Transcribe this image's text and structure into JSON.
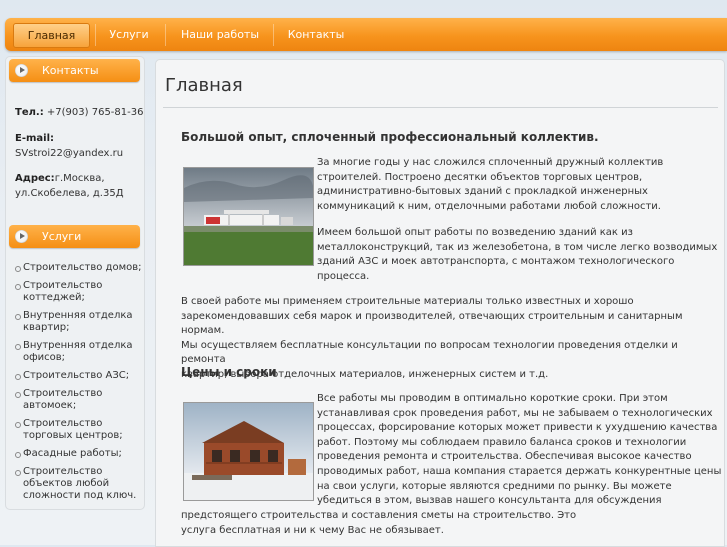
{
  "nav": {
    "items": [
      {
        "label": "Главная",
        "active": true
      },
      {
        "label": "Услуги"
      },
      {
        "label": "Наши работы"
      },
      {
        "label": "Контакты"
      }
    ]
  },
  "sidebar": {
    "contacts_title": "Контакты",
    "phone_label": "Тел.:",
    "phone_value": " +7(903) 765-81-36",
    "email_label": "E-mail:",
    "email_value": "SVstroi22@yandex.ru",
    "address_label": "Адрес:",
    "address_line1": "г.Москва,",
    "address_line2": "ул.Скобелева, д.35Д",
    "services_title": "Услуги",
    "services": [
      "Строительство домов;",
      "Строительство коттеджей;",
      "Внутренняя отделка квартир;",
      "Внутренняя отделка офисов;",
      "Строительство АЗС;",
      "Строительство автомоек;",
      "Строительство торговых центров;",
      "Фасадные работы;",
      "Строительство объектов любой сложности под ключ."
    ]
  },
  "main": {
    "title": "Главная",
    "heading1": "Большой опыт, сплоченный профессиональный коллектив.",
    "para1": [
      "За многие годы у нас сложился сплоченный дружный коллектив",
      "строителей. Построено десятки объектов торговых центров,",
      "административно-бытовых зданий с прокладкой инженерных",
      "коммуникаций к ним, отделочными работами любой сложности."
    ],
    "para2": [
      "Имеем большой опыт работы по возведению   зданий как из",
      "металлоконструкций, так из железобетона, в том числе легко возводимых",
      "зданий АЗС и моек автотранспорта, с  монтажом технологического",
      " процесса."
    ],
    "para3": [
      "В своей работе мы применяем строительные материалы только известных и хорошо",
      "зарекомендовавших себя марок и производителей, отвечающих строительным и санитарным нормам.",
      "Мы осуществляем бесплатные консультации по вопросам технологии проведения отделки и ремонта",
      "квартир, выбора отделочных материалов, инженерных систем и т.д."
    ],
    "heading2": "Цены и сроки",
    "para4": [
      "Все работы мы проводим в оптимально короткие сроки. При этом",
      "устанавливая срок проведения работ, мы не забываем о технологических",
      "процессах, форсирование которых может привести к ухудшению качества",
      "работ. Поэтому мы соблюдаем правило баланса сроков и технологии",
      "проведения ремонта и строительства. Обеспечивая высокое качество",
      "проводимых работ, наша компания старается держать конкурентные цены",
      "на свои услуги, которые являются средними по рынку. Вы можете",
      "убедиться в этом, вызвав нашего консультанта для обсуждения",
      "предстоящего строительства и составления сметы на строительство. Это",
      "услуга бесплатная и ни к чему Вас не обязывает."
    ]
  },
  "colors": {
    "accent": "#f7941d",
    "accent_light": "#ffb24a"
  }
}
